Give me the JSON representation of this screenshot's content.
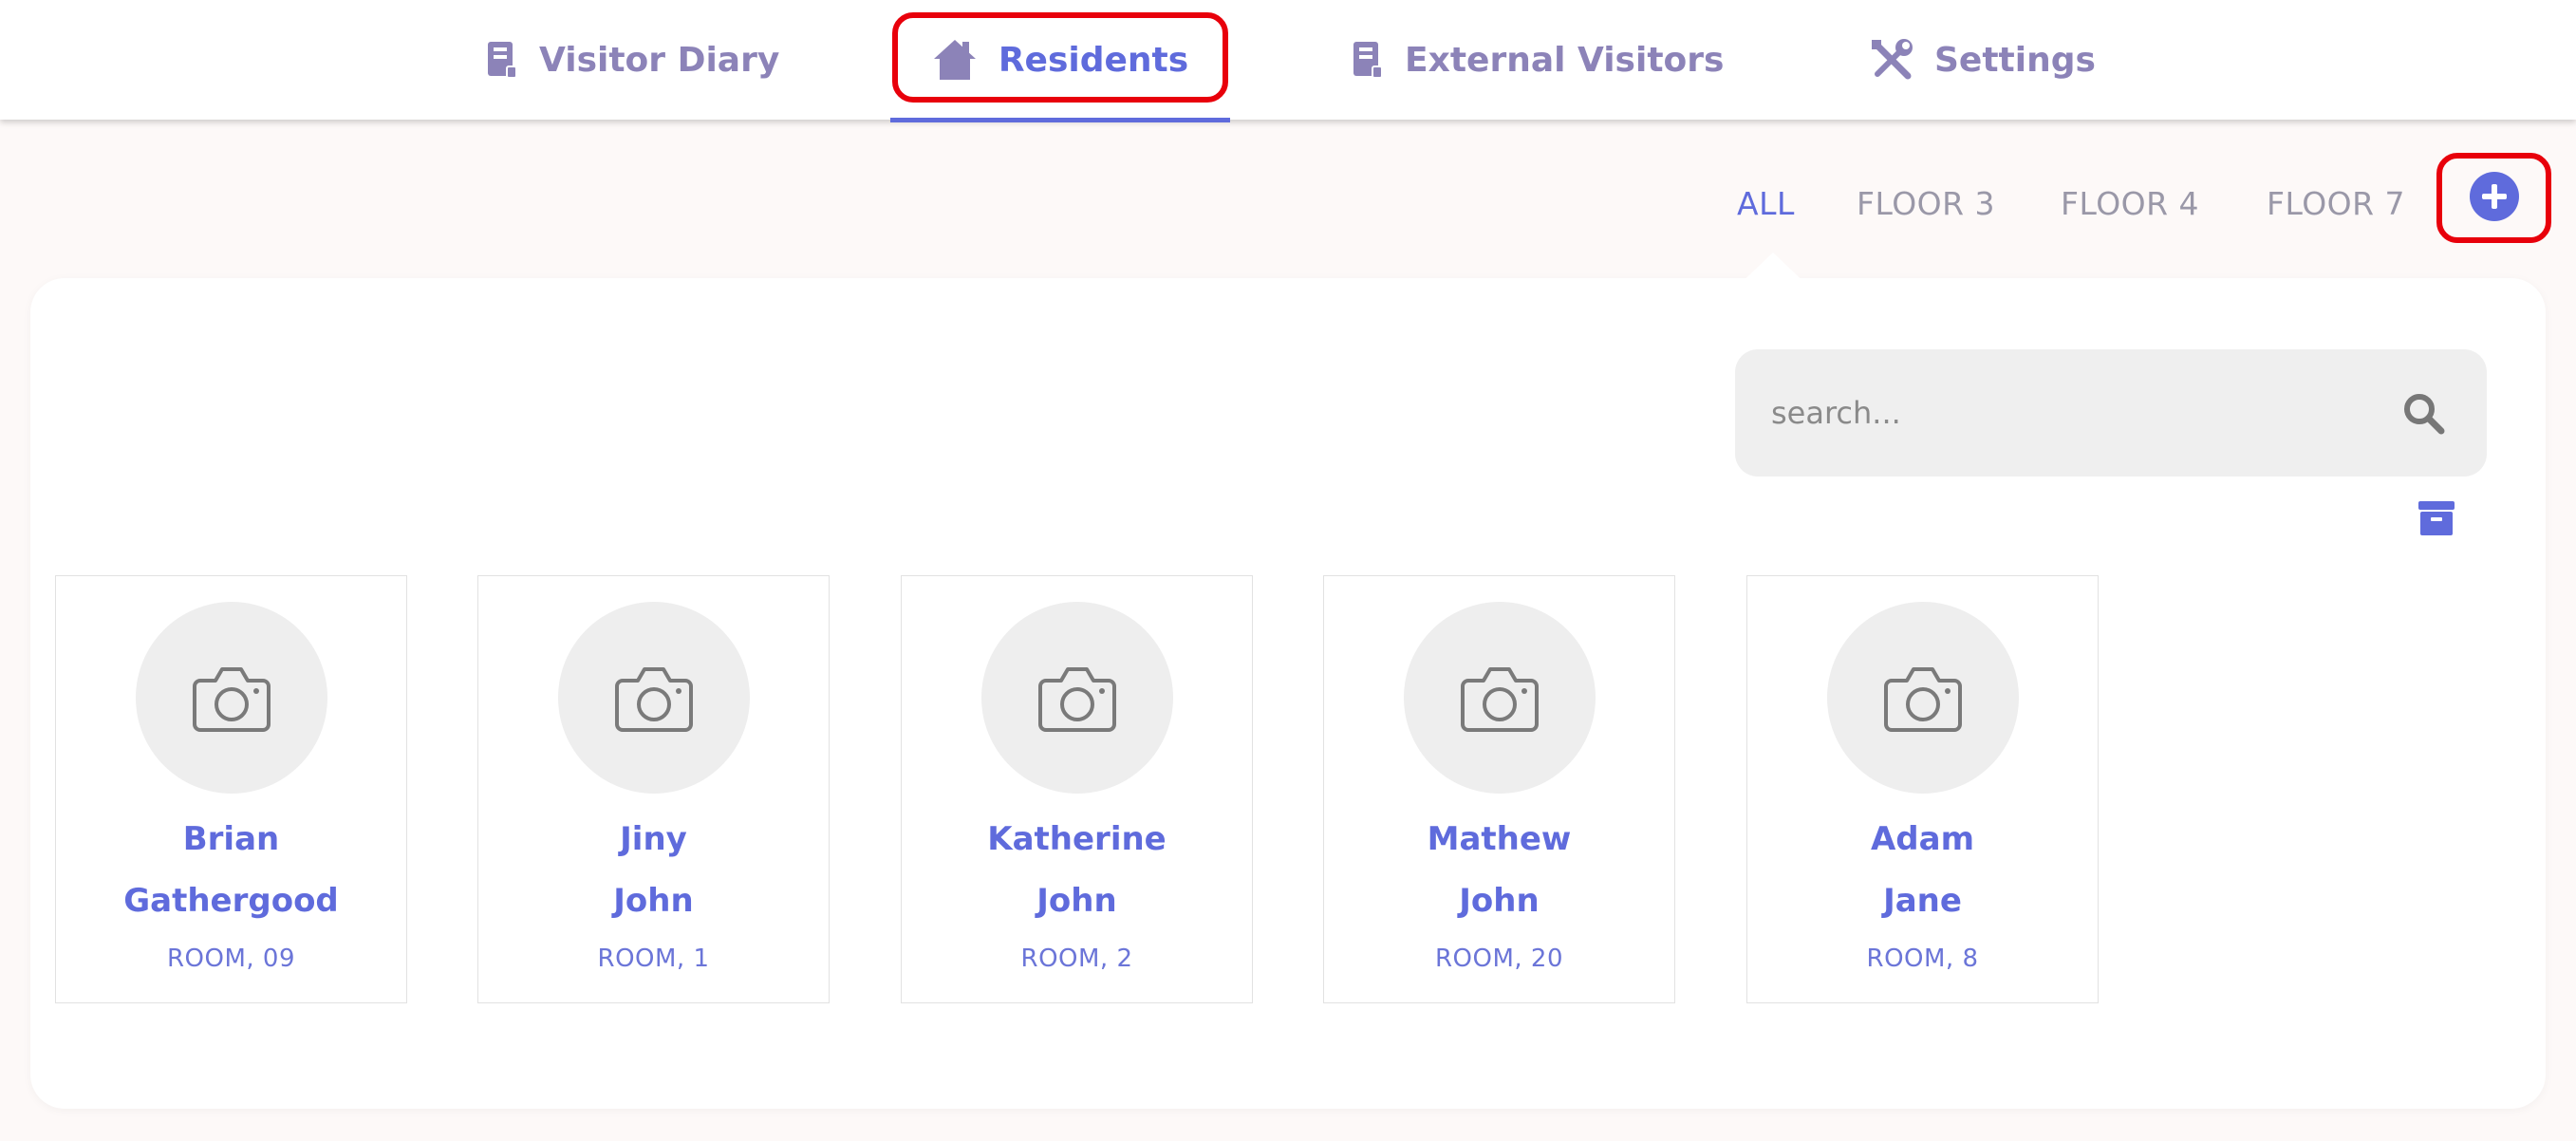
{
  "nav": {
    "tabs": [
      {
        "label": "Visitor Diary",
        "icon": "book-icon"
      },
      {
        "label": "Residents",
        "icon": "house-icon",
        "active": true
      },
      {
        "label": "External Visitors",
        "icon": "book-icon"
      },
      {
        "label": "Settings",
        "icon": "tools-icon"
      }
    ]
  },
  "filters": [
    {
      "label": "ALL",
      "active": true
    },
    {
      "label": "FLOOR 3",
      "active": false
    },
    {
      "label": "FLOOR 4",
      "active": false
    },
    {
      "label": "FLOOR 7",
      "active": false
    }
  ],
  "search": {
    "placeholder": "search...",
    "value": ""
  },
  "residents": [
    {
      "first": "Brian",
      "last": "Gathergood",
      "room": "ROOM, 09"
    },
    {
      "first": "Jiny",
      "last": "John",
      "room": "ROOM, 1"
    },
    {
      "first": "Katherine",
      "last": "John",
      "room": "ROOM, 2"
    },
    {
      "first": "Mathew",
      "last": "John",
      "room": "ROOM, 20"
    },
    {
      "first": "Adam",
      "last": "Jane",
      "room": "ROOM, 8"
    }
  ],
  "colors": {
    "accent": "#5f6bdc",
    "nav_inactive": "#8c83b8",
    "highlight": "#e8000b",
    "background": "#fdf9f8",
    "avatar_bg": "#eeeeee"
  }
}
